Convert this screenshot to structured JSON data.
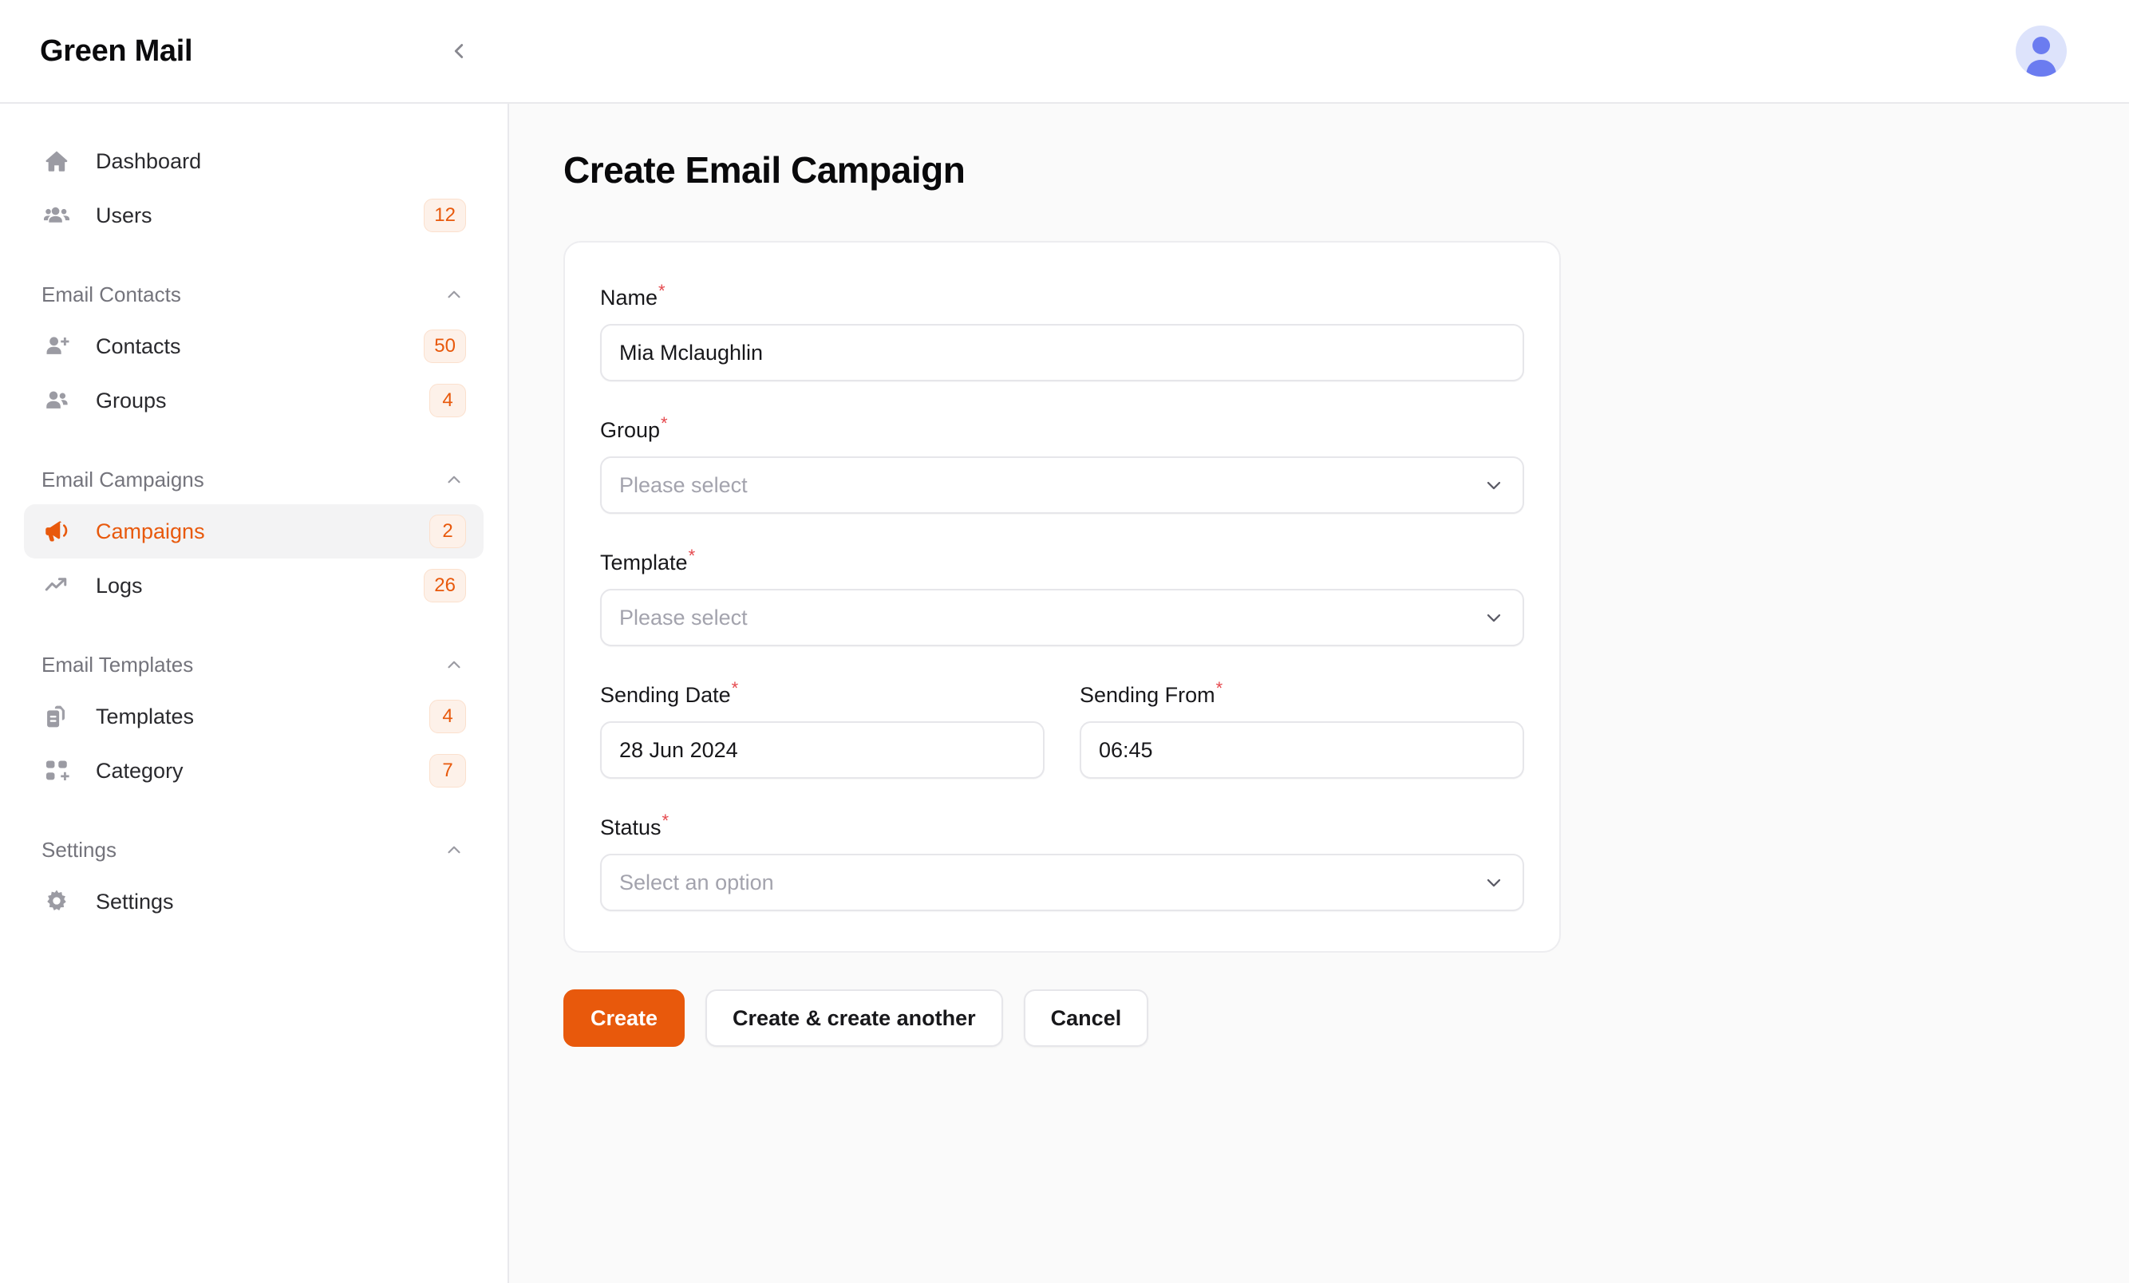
{
  "app": {
    "brand": "Green Mail",
    "collapse_icon": "chevron-left-icon",
    "avatar_icon": "user-avatar-icon"
  },
  "sidebar": {
    "top_items": [
      {
        "label": "Dashboard",
        "icon": "home-icon",
        "badge": "",
        "active": false
      },
      {
        "label": "Users",
        "icon": "users-group-icon",
        "badge": "12",
        "active": false
      }
    ],
    "sections": [
      {
        "title": "Email Contacts",
        "chevron": "chevron-up-icon",
        "items": [
          {
            "label": "Contacts",
            "icon": "user-plus-icon",
            "badge": "50",
            "active": false
          },
          {
            "label": "Groups",
            "icon": "people-icon",
            "badge": "4",
            "active": false
          }
        ]
      },
      {
        "title": "Email Campaigns",
        "chevron": "chevron-up-icon",
        "items": [
          {
            "label": "Campaigns",
            "icon": "megaphone-icon",
            "badge": "2",
            "active": true
          },
          {
            "label": "Logs",
            "icon": "trending-up-icon",
            "badge": "26",
            "active": false
          }
        ]
      },
      {
        "title": "Email Templates",
        "chevron": "chevron-up-icon",
        "items": [
          {
            "label": "Templates",
            "icon": "template-copy-icon",
            "badge": "4",
            "active": false
          },
          {
            "label": "Category",
            "icon": "category-grid-plus-icon",
            "badge": "7",
            "active": false
          }
        ]
      },
      {
        "title": "Settings",
        "chevron": "chevron-up-icon",
        "items": [
          {
            "label": "Settings",
            "icon": "gear-icon",
            "badge": "",
            "active": false
          }
        ]
      }
    ]
  },
  "main": {
    "page_title": "Create Email Campaign",
    "form": {
      "name": {
        "label": "Name",
        "required_marker": "*",
        "value": "Mia Mclaughlin",
        "placeholder": ""
      },
      "group": {
        "label": "Group",
        "required_marker": "*",
        "value": "",
        "placeholder": "Please select",
        "caret_icon": "chevron-down-icon"
      },
      "template": {
        "label": "Template",
        "required_marker": "*",
        "value": "",
        "placeholder": "Please select",
        "caret_icon": "chevron-down-icon"
      },
      "sending_date": {
        "label": "Sending Date",
        "required_marker": "*",
        "value": "28 Jun 2024",
        "placeholder": ""
      },
      "sending_from": {
        "label": "Sending From",
        "required_marker": "*",
        "value": "06:45",
        "placeholder": ""
      },
      "status": {
        "label": "Status",
        "required_marker": "*",
        "value": "",
        "placeholder": "Select an option",
        "caret_icon": "chevron-down-icon"
      }
    },
    "actions": {
      "create": "Create",
      "create_another": "Create & create another",
      "cancel": "Cancel"
    }
  },
  "colors": {
    "accent": "#e8590c",
    "badge_bg": "#fdf1e9",
    "badge_border": "#fbe0cd",
    "required_red": "#e5484d",
    "main_bg": "#fafafa",
    "border": "#e9e9ec",
    "avatar_bg": "#dde3fb",
    "avatar_fg": "#6b7cf0"
  }
}
